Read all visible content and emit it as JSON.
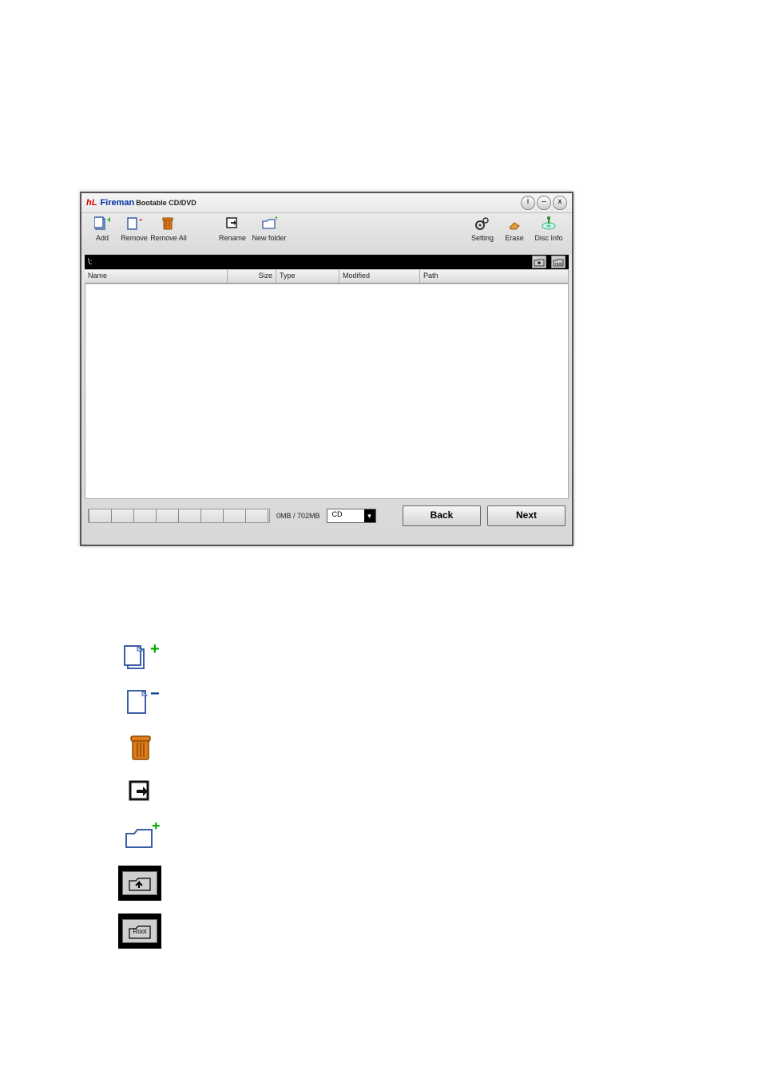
{
  "title": {
    "logo": "hL",
    "brand": "Fireman",
    "sub": "Bootable CD/DVD"
  },
  "window_buttons": {
    "info": "i",
    "min": "–",
    "close": "x"
  },
  "toolbar": {
    "add": "Add",
    "remove": "Remove",
    "remove_all": "Remove All",
    "rename": "Rename",
    "new_folder": "New folder",
    "setting": "Setting",
    "erase": "Erase",
    "disc_info": "Disc Info"
  },
  "pathbar": {
    "root": "\\:"
  },
  "columns": {
    "name": "Name",
    "size": "Size",
    "type": "Type",
    "modified": "Modified",
    "path": "Path"
  },
  "bottom": {
    "size_label": "0MB / 702MB",
    "media_value": "CD",
    "back": "Back",
    "next": "Next"
  },
  "standalone_tiles": {
    "root_label": "Root"
  }
}
